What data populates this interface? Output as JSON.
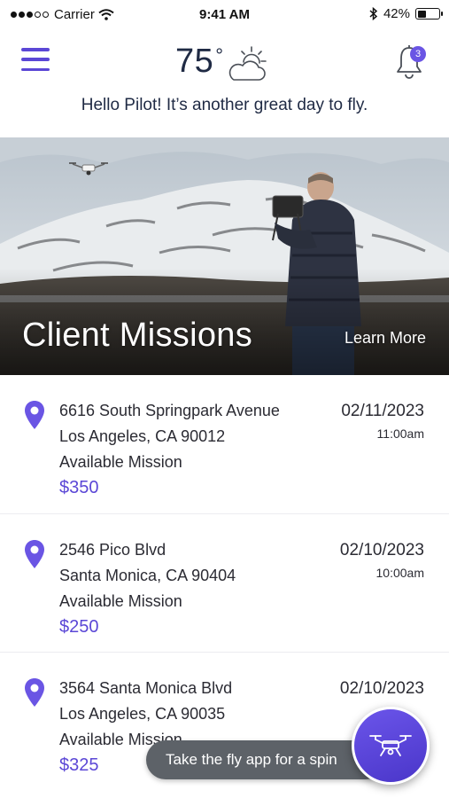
{
  "status_bar": {
    "carrier": "Carrier",
    "time": "9:41 AM",
    "battery": "42%",
    "battery_level": 0.42
  },
  "header": {
    "temperature": "75",
    "degree_symbol": "°",
    "weather_icon": "partly-cloudy-icon",
    "menu_icon": "hamburger-menu-icon",
    "notification_icon": "bell-icon",
    "notification_count": "3"
  },
  "greeting": "Hello Pilot! It’s another great day to fly.",
  "hero": {
    "title": "Client Missions",
    "link": "Learn More"
  },
  "missions": [
    {
      "address": "6616 South Springpark Avenue",
      "city": "Los Angeles, CA 90012",
      "status": "Available Mission",
      "price": "$350",
      "date": "02/11/2023",
      "time": "11:00am"
    },
    {
      "address": "2546 Pico Blvd",
      "city": "Santa Monica, CA 90404",
      "status": "Available Mission",
      "price": "$250",
      "date": "02/10/2023",
      "time": "10:00am"
    },
    {
      "address": "3564 Santa Monica Blvd",
      "city": "Los Angeles, CA 90035",
      "status": "Available Mission",
      "price": "$325",
      "date": "02/10/2023",
      "time": ""
    }
  ],
  "toast": "Take the fly app for a spin",
  "fab_icon": "drone-icon",
  "colors": {
    "accent": "#5b47d6",
    "text": "#2b2b33",
    "toast": "#5d6268"
  }
}
